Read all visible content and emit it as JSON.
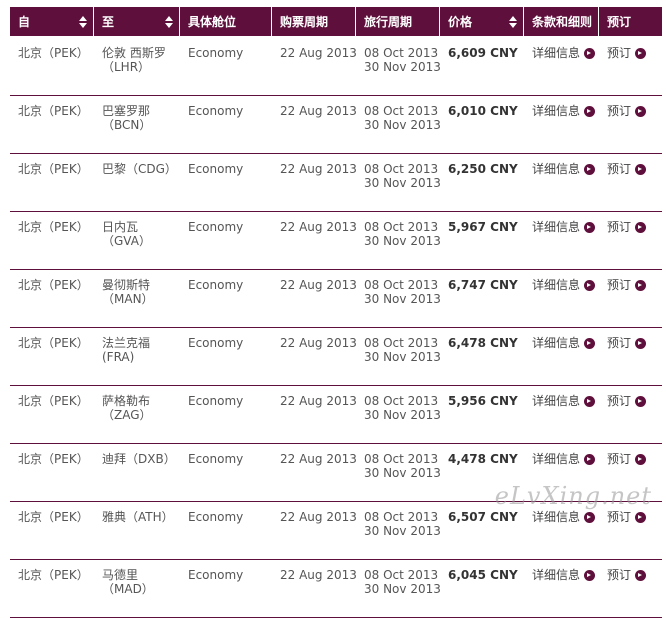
{
  "table": {
    "headers": [
      {
        "label": "自",
        "sortable": true
      },
      {
        "label": "至",
        "sortable": true
      },
      {
        "label": "具体舱位",
        "sortable": false
      },
      {
        "label": "购票周期",
        "sortable": false
      },
      {
        "label": "旅行周期",
        "sortable": false
      },
      {
        "label": "价格",
        "sortable": true
      },
      {
        "label": "条款和细则",
        "sortable": false
      },
      {
        "label": "预订",
        "sortable": false
      }
    ],
    "rows": [
      {
        "from": "北京（PEK）",
        "to1": "伦敦 西斯罗",
        "to2": "（LHR）",
        "cabin": "Economy",
        "ticketing": "22 Aug 2013",
        "travel1": "08 Oct 2013",
        "travel2": "30 Nov 2013",
        "price": "6,609 CNY",
        "details": "详细信息",
        "book": "预订"
      },
      {
        "from": "北京（PEK）",
        "to1": "巴塞罗那",
        "to2": "（BCN）",
        "cabin": "Economy",
        "ticketing": "22 Aug 2013",
        "travel1": "08 Oct 2013",
        "travel2": "30 Nov 2013",
        "price": "6,010 CNY",
        "details": "详细信息",
        "book": "预订"
      },
      {
        "from": "北京（PEK）",
        "to1": "巴黎（CDG）",
        "to2": "",
        "cabin": "Economy",
        "ticketing": "22 Aug 2013",
        "travel1": "08 Oct 2013",
        "travel2": "30 Nov 2013",
        "price": "6,250 CNY",
        "details": "详细信息",
        "book": "预订"
      },
      {
        "from": "北京（PEK）",
        "to1": "日内瓦",
        "to2": "（GVA）",
        "cabin": "Economy",
        "ticketing": "22 Aug 2013",
        "travel1": "08 Oct 2013",
        "travel2": "30 Nov 2013",
        "price": "5,967 CNY",
        "details": "详细信息",
        "book": "预订"
      },
      {
        "from": "北京（PEK）",
        "to1": "曼彻斯特",
        "to2": "（MAN）",
        "cabin": "Economy",
        "ticketing": "22 Aug 2013",
        "travel1": "08 Oct 2013",
        "travel2": "30 Nov 2013",
        "price": "6,747 CNY",
        "details": "详细信息",
        "book": "预订"
      },
      {
        "from": "北京（PEK）",
        "to1": "法兰克福",
        "to2": "(FRA)",
        "cabin": "Economy",
        "ticketing": "22 Aug 2013",
        "travel1": "08 Oct 2013",
        "travel2": "30 Nov 2013",
        "price": "6,478 CNY",
        "details": "详细信息",
        "book": "预订"
      },
      {
        "from": "北京（PEK）",
        "to1": "萨格勒布",
        "to2": "（ZAG）",
        "cabin": "Economy",
        "ticketing": "22 Aug 2013",
        "travel1": "08 Oct 2013",
        "travel2": "30 Nov 2013",
        "price": "5,956 CNY",
        "details": "详细信息",
        "book": "预订"
      },
      {
        "from": "北京（PEK）",
        "to1": "迪拜（DXB）",
        "to2": "",
        "cabin": "Economy",
        "ticketing": "22 Aug 2013",
        "travel1": "08 Oct 2013",
        "travel2": "30 Nov 2013",
        "price": "4,478 CNY",
        "details": "详细信息",
        "book": "预订"
      },
      {
        "from": "北京（PEK）",
        "to1": "雅典（ATH）",
        "to2": "",
        "cabin": "Economy",
        "ticketing": "22 Aug 2013",
        "travel1": "08 Oct 2013",
        "travel2": "30 Nov 2013",
        "price": "6,507 CNY",
        "details": "详细信息",
        "book": "预订"
      },
      {
        "from": "北京（PEK）",
        "to1": "马德里",
        "to2": "（MAD）",
        "cabin": "Economy",
        "ticketing": "22 Aug 2013",
        "travel1": "08 Oct 2013",
        "travel2": "30 Nov 2013",
        "price": "6,045 CNY",
        "details": "详细信息",
        "book": "预订"
      }
    ]
  },
  "watermark": "eLvXing.net",
  "colors": {
    "header_bg": "#5f0f3b",
    "border": "#5f0f3b",
    "arrow": "#5f0f3b"
  },
  "icons": {
    "sort": "sort-arrows-icon",
    "link": "circle-arrow-right-icon"
  }
}
